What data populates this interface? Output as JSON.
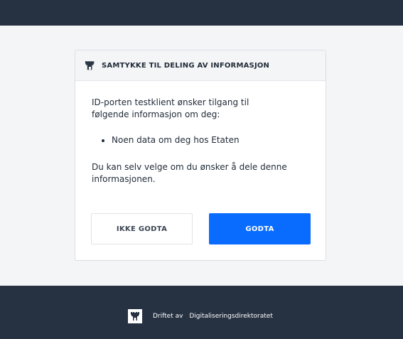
{
  "header": {
    "title": "SAMTYKKE TIL DELING AV INFORMASJON",
    "icon": "castle-icon"
  },
  "body": {
    "intro": "ID-porten testklient ønsker tilgang til følgende informasjon om deg:",
    "items": [
      "Noen data om deg hos Etaten"
    ],
    "outro": "Du kan selv velge om du ønsker å dele denne informasjonen."
  },
  "buttons": {
    "decline_label": "IKKE GODTA",
    "accept_label": "GODTA"
  },
  "footer": {
    "prefix": "Driftet av",
    "organization": "Digitaliseringsdirektoratet",
    "icon": "castle-logo-icon"
  },
  "colors": {
    "dark": "#263242",
    "accent": "#0a6cff",
    "background": "#f4f5f7"
  }
}
